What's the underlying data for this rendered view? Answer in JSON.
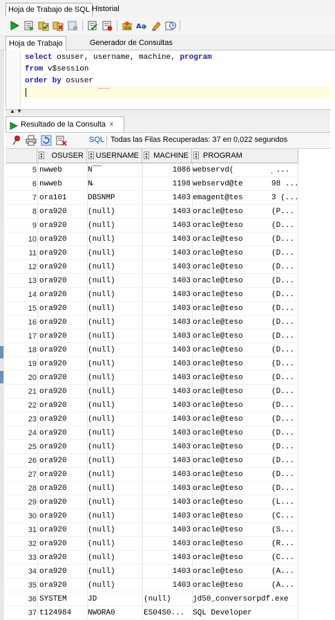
{
  "tabs": {
    "worksheet": "Hoja de Trabajo de SQL",
    "history": "Historial"
  },
  "subtabs": {
    "worksheet": "Hoja de Trabajo",
    "query_builder": "Generador de Consultas"
  },
  "editor": {
    "line1_kw1": "select",
    "line1_rest": " osuser, username, machine, ",
    "line1_kw2": "program",
    "line2_kw": "from",
    "line2_rest": " v$session",
    "line3_kw": "order by",
    "line3_rest": " osuser"
  },
  "result": {
    "tab_label": "Resultado de la Consulta",
    "tab_close": "x",
    "sql_link": "SQL",
    "status": "Todas las Filas Recuperadas: 37 en 0,022 segundos"
  },
  "columns": [
    "OSUSER",
    "USERNAME",
    "MACHINE",
    "PROGRAM"
  ],
  "rows": [
    {
      "n": "5",
      "osuser": "nwweb",
      "username": "N‾‾",
      "machine": "1086",
      "program": "webservd(",
      "extra": "̧ ..."
    },
    {
      "n": "6",
      "osuser": "nwweb",
      "username": "N̵",
      "machine": "1198",
      "program": "webservd@te",
      "extra": "98 ..."
    },
    {
      "n": "7",
      "osuser": "ora101",
      "username": "DBSNMP",
      "machine": "1403",
      "program": "emagent@tes",
      "extra": "3 (..."
    },
    {
      "n": "8",
      "osuser": "ora920",
      "username": "(null)",
      "machine": "1403",
      "program": "oracle@teso",
      "extra": "(P..."
    },
    {
      "n": "9",
      "osuser": "ora920",
      "username": "(null)",
      "machine": "1403",
      "program": "oracle@teso",
      "extra": "(D..."
    },
    {
      "n": "10",
      "osuser": "ora920",
      "username": "(null)",
      "machine": "1403",
      "program": "oracle@teso",
      "extra": "(D..."
    },
    {
      "n": "11",
      "osuser": "ora920",
      "username": "(null)",
      "machine": "1403",
      "program": "oracle@teso",
      "extra": "(D..."
    },
    {
      "n": "12",
      "osuser": "ora920",
      "username": "(null)",
      "machine": "1403",
      "program": "oracle@teso",
      "extra": "(D..."
    },
    {
      "n": "13",
      "osuser": "ora920",
      "username": "(null)",
      "machine": "1403",
      "program": "oracle@teso",
      "extra": "(D..."
    },
    {
      "n": "14",
      "osuser": "ora920",
      "username": "(null)",
      "machine": "1403",
      "program": "oracle@teso",
      "extra": "(D..."
    },
    {
      "n": "15",
      "osuser": "ora920",
      "username": "(null)",
      "machine": "1403",
      "program": "oracle@teso",
      "extra": "(D..."
    },
    {
      "n": "16",
      "osuser": "ora920",
      "username": "(null)",
      "machine": "1403",
      "program": "oracle@teso",
      "extra": "(D..."
    },
    {
      "n": "17",
      "osuser": "ora920",
      "username": "(null)",
      "machine": "1403",
      "program": "oracle@teso",
      "extra": "(D..."
    },
    {
      "n": "18",
      "osuser": "ora920",
      "username": "(null)",
      "machine": "1403",
      "program": "oracle@teso",
      "extra": "(D..."
    },
    {
      "n": "19",
      "osuser": "ora920",
      "username": "(null)",
      "machine": "1403",
      "program": "oracle@teso",
      "extra": "(D..."
    },
    {
      "n": "20",
      "osuser": "ora920",
      "username": "(null)",
      "machine": "1403",
      "program": "oracle@teso",
      "extra": "(D..."
    },
    {
      "n": "21",
      "osuser": "ora920",
      "username": "(null)",
      "machine": "1403",
      "program": "oracle@teso",
      "extra": "(D..."
    },
    {
      "n": "22",
      "osuser": "ora920",
      "username": "(null)",
      "machine": "1403",
      "program": "oracle@teso",
      "extra": "(D..."
    },
    {
      "n": "23",
      "osuser": "ora920",
      "username": "(null)",
      "machine": "1403",
      "program": "oracle@teso",
      "extra": "(D..."
    },
    {
      "n": "24",
      "osuser": "ora920",
      "username": "(null)",
      "machine": "1403",
      "program": "oracle@teso",
      "extra": "(D..."
    },
    {
      "n": "25",
      "osuser": "ora920",
      "username": "(null)",
      "machine": "1403",
      "program": "oracle@teso",
      "extra": "(D..."
    },
    {
      "n": "26",
      "osuser": "ora920",
      "username": "(null)",
      "machine": "1403",
      "program": "oracle@teso",
      "extra": "(D..."
    },
    {
      "n": "27",
      "osuser": "ora920",
      "username": "(null)",
      "machine": "1403",
      "program": "oracle@teso",
      "extra": "(D..."
    },
    {
      "n": "28",
      "osuser": "ora920",
      "username": "(null)",
      "machine": "1403",
      "program": "oracle@teso",
      "extra": "(D..."
    },
    {
      "n": "29",
      "osuser": "ora920",
      "username": "(null)",
      "machine": "1403",
      "program": "oracle@teso",
      "extra": "(L..."
    },
    {
      "n": "30",
      "osuser": "ora920",
      "username": "(null)",
      "machine": "1403",
      "program": "oracle@teso",
      "extra": "(C..."
    },
    {
      "n": "31",
      "osuser": "ora920",
      "username": "(null)",
      "machine": "1403",
      "program": "oracle@teso",
      "extra": "(S..."
    },
    {
      "n": "32",
      "osuser": "ora920",
      "username": "(null)",
      "machine": "1403",
      "program": "oracle@teso",
      "extra": "(R..."
    },
    {
      "n": "33",
      "osuser": "ora920",
      "username": "(null)",
      "machine": "1403",
      "program": "oracle@teso",
      "extra": "(C..."
    },
    {
      "n": "34",
      "osuser": "ora920",
      "username": "(null)",
      "machine": "1403",
      "program": "oracle@teso",
      "extra": "(A..."
    },
    {
      "n": "35",
      "osuser": "ora920",
      "username": "(null)",
      "machine": "1403",
      "program": "oracle@teso",
      "extra": "(A..."
    },
    {
      "n": "36",
      "osuser": "SYSTEM",
      "username": "JD",
      "machine": "(null)",
      "program": "jd50_conversorpdf.exe",
      "extra": ""
    },
    {
      "n": "37",
      "osuser": "t124984",
      "username": "NWORA0",
      "machine": "ES04S0...",
      "program": "SQL Developer",
      "extra": ""
    }
  ],
  "colors": {
    "keyword": "#1f1fa8",
    "accent": "#6a8fbf",
    "sql_link": "#1a4fa0"
  }
}
